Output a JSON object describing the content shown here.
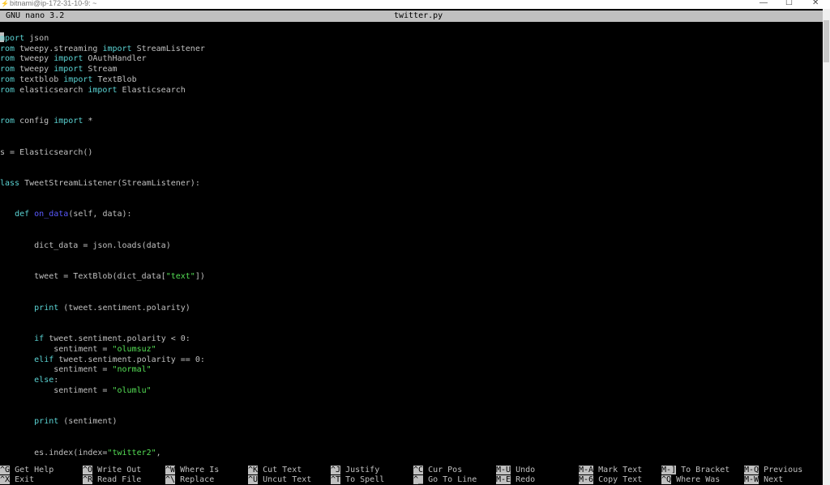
{
  "window": {
    "title": "bitnami@ip-172-31-10-9: ~",
    "minimize": "—",
    "maximize": "☐",
    "close": "✕"
  },
  "nano": {
    "version": "GNU nano 3.2",
    "filename": "twitter.py"
  },
  "code_lines": [
    {
      "row": 1,
      "indent": 0,
      "parts": [
        {
          "t": "mport",
          "c": "kw"
        },
        {
          "t": " json"
        }
      ]
    },
    {
      "row": 2,
      "indent": 0,
      "parts": [
        {
          "t": "rom",
          "c": "kw"
        },
        {
          "t": " tweepy.streaming "
        },
        {
          "t": "import",
          "c": "kw"
        },
        {
          "t": " StreamListener"
        }
      ]
    },
    {
      "row": 3,
      "indent": 0,
      "parts": [
        {
          "t": "rom",
          "c": "kw"
        },
        {
          "t": " tweepy "
        },
        {
          "t": "import",
          "c": "kw"
        },
        {
          "t": " OAuthHandler"
        }
      ]
    },
    {
      "row": 4,
      "indent": 0,
      "parts": [
        {
          "t": "rom",
          "c": "kw"
        },
        {
          "t": " tweepy "
        },
        {
          "t": "import",
          "c": "kw"
        },
        {
          "t": " Stream"
        }
      ]
    },
    {
      "row": 5,
      "indent": 0,
      "parts": [
        {
          "t": "rom",
          "c": "kw"
        },
        {
          "t": " textblob "
        },
        {
          "t": "import",
          "c": "kw"
        },
        {
          "t": " TextBlob"
        }
      ]
    },
    {
      "row": 6,
      "indent": 0,
      "parts": [
        {
          "t": "rom",
          "c": "kw"
        },
        {
          "t": " elasticsearch "
        },
        {
          "t": "import",
          "c": "kw"
        },
        {
          "t": " Elasticsearch"
        }
      ]
    },
    {
      "row": 9,
      "indent": 0,
      "parts": [
        {
          "t": "rom",
          "c": "kw"
        },
        {
          "t": " config "
        },
        {
          "t": "import",
          "c": "kw"
        },
        {
          "t": " *"
        }
      ]
    },
    {
      "row": 12,
      "indent": 0,
      "parts": [
        {
          "t": "s = Elasticsearch()"
        }
      ]
    },
    {
      "row": 15,
      "indent": 0,
      "parts": [
        {
          "t": "lass",
          "c": "kw"
        },
        {
          "t": " TweetStreamListener(StreamListener):"
        }
      ]
    },
    {
      "row": 18,
      "indent": 0,
      "parts": [
        {
          "t": "   "
        },
        {
          "t": "def",
          "c": "kw"
        },
        {
          "t": " "
        },
        {
          "t": "on_data",
          "c": "fn"
        },
        {
          "t": "(self, data):"
        }
      ]
    },
    {
      "row": 21,
      "indent": 0,
      "parts": [
        {
          "t": "       dict_data = json.loads(data)"
        }
      ]
    },
    {
      "row": 24,
      "indent": 0,
      "parts": [
        {
          "t": "       tweet = TextBlob(dict_data["
        },
        {
          "t": "\"text\"",
          "c": "str"
        },
        {
          "t": "])"
        }
      ]
    },
    {
      "row": 27,
      "indent": 0,
      "parts": [
        {
          "t": "       "
        },
        {
          "t": "print",
          "c": "kw"
        },
        {
          "t": " (tweet.sentiment.polarity)"
        }
      ]
    },
    {
      "row": 30,
      "indent": 0,
      "parts": [
        {
          "t": "       "
        },
        {
          "t": "if",
          "c": "kw"
        },
        {
          "t": " tweet.sentiment.polarity < 0:"
        }
      ]
    },
    {
      "row": 31,
      "indent": 0,
      "parts": [
        {
          "t": "           sentiment = "
        },
        {
          "t": "\"olumsuz\"",
          "c": "str"
        }
      ]
    },
    {
      "row": 32,
      "indent": 0,
      "parts": [
        {
          "t": "       "
        },
        {
          "t": "elif",
          "c": "kw"
        },
        {
          "t": " tweet.sentiment.polarity == 0:"
        }
      ]
    },
    {
      "row": 33,
      "indent": 0,
      "parts": [
        {
          "t": "           sentiment = "
        },
        {
          "t": "\"normal\"",
          "c": "str"
        }
      ]
    },
    {
      "row": 34,
      "indent": 0,
      "parts": [
        {
          "t": "       "
        },
        {
          "t": "else",
          "c": "kw"
        },
        {
          "t": ":"
        }
      ]
    },
    {
      "row": 35,
      "indent": 0,
      "parts": [
        {
          "t": "           sentiment = "
        },
        {
          "t": "\"olumlu\"",
          "c": "str"
        }
      ]
    },
    {
      "row": 38,
      "indent": 0,
      "parts": [
        {
          "t": "       "
        },
        {
          "t": "print",
          "c": "kw"
        },
        {
          "t": " (sentiment)"
        }
      ]
    },
    {
      "row": 41,
      "indent": 0,
      "parts": [
        {
          "t": "       es.index(index="
        },
        {
          "t": "\"twitter2\"",
          "c": "str"
        },
        {
          "t": ","
        }
      ]
    }
  ],
  "shortcuts": [
    {
      "row": 0,
      "col": 0,
      "key": "^G",
      "label": "Get Help"
    },
    {
      "row": 1,
      "col": 0,
      "key": "^X",
      "label": "Exit"
    },
    {
      "row": 0,
      "col": 1,
      "key": "^O",
      "label": "Write Out"
    },
    {
      "row": 1,
      "col": 1,
      "key": "^R",
      "label": "Read File"
    },
    {
      "row": 0,
      "col": 2,
      "key": "^W",
      "label": "Where Is"
    },
    {
      "row": 1,
      "col": 2,
      "key": "^\\",
      "label": "Replace"
    },
    {
      "row": 0,
      "col": 3,
      "key": "^K",
      "label": "Cut Text"
    },
    {
      "row": 1,
      "col": 3,
      "key": "^U",
      "label": "Uncut Text"
    },
    {
      "row": 0,
      "col": 4,
      "key": "^J",
      "label": "Justify"
    },
    {
      "row": 1,
      "col": 4,
      "key": "^T",
      "label": "To Spell"
    },
    {
      "row": 0,
      "col": 5,
      "key": "^C",
      "label": "Cur Pos"
    },
    {
      "row": 1,
      "col": 5,
      "key": "^_",
      "label": "Go To Line"
    },
    {
      "row": 0,
      "col": 6,
      "key": "M-U",
      "label": "Undo"
    },
    {
      "row": 1,
      "col": 6,
      "key": "M-E",
      "label": "Redo"
    },
    {
      "row": 0,
      "col": 7,
      "key": "M-A",
      "label": "Mark Text"
    },
    {
      "row": 1,
      "col": 7,
      "key": "M-6",
      "label": "Copy Text"
    },
    {
      "row": 0,
      "col": 8,
      "key": "M-]",
      "label": "To Bracket"
    },
    {
      "row": 1,
      "col": 8,
      "key": "^Q",
      "label": "Where Was"
    },
    {
      "row": 0,
      "col": 9,
      "key": "M-Q",
      "label": "Previous"
    },
    {
      "row": 1,
      "col": 9,
      "key": "M-W",
      "label": "Next"
    }
  ],
  "colors": {
    "keyword": "#5bd4d4",
    "function": "#5a5aff",
    "string": "#55e055",
    "text": "#c0c0c0",
    "background": "#000000"
  }
}
